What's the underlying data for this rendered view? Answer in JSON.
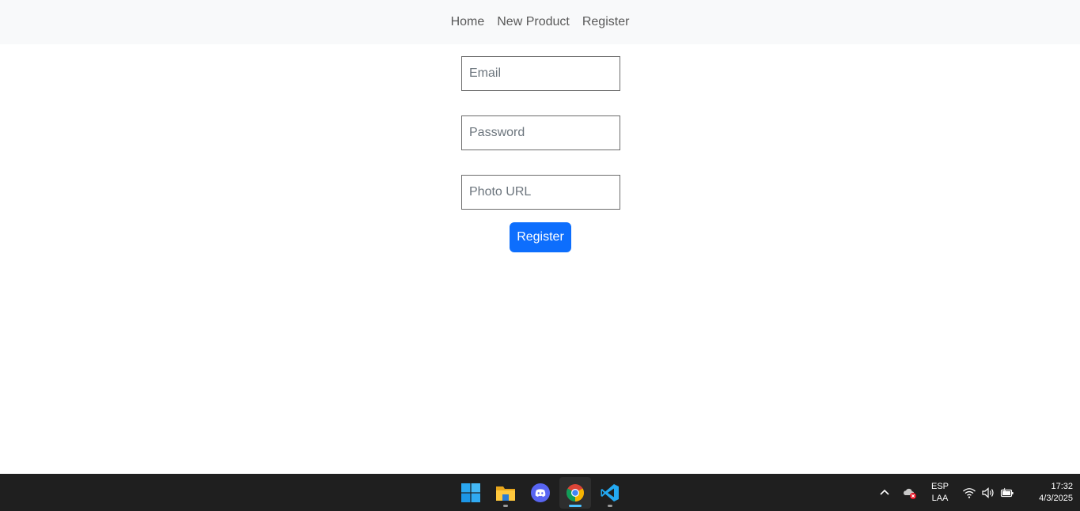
{
  "nav": {
    "items": [
      {
        "label": "Home"
      },
      {
        "label": "New Product"
      },
      {
        "label": "Register"
      }
    ]
  },
  "form": {
    "email_placeholder": "Email",
    "password_placeholder": "Password",
    "photo_placeholder": "Photo URL",
    "submit_label": "Register"
  },
  "taskbar": {
    "apps": [
      "windows-start-icon",
      "file-explorer-icon",
      "discord-icon",
      "chrome-icon",
      "vscode-icon"
    ],
    "active_app": "chrome-icon",
    "language_line1": "ESP",
    "language_line2": "LAA",
    "time": "17:32",
    "date": "4/3/2025"
  },
  "colors": {
    "navbar_bg": "#f8f9fa",
    "primary": "#0d6efd",
    "taskbar_bg": "#1f1f1f"
  }
}
